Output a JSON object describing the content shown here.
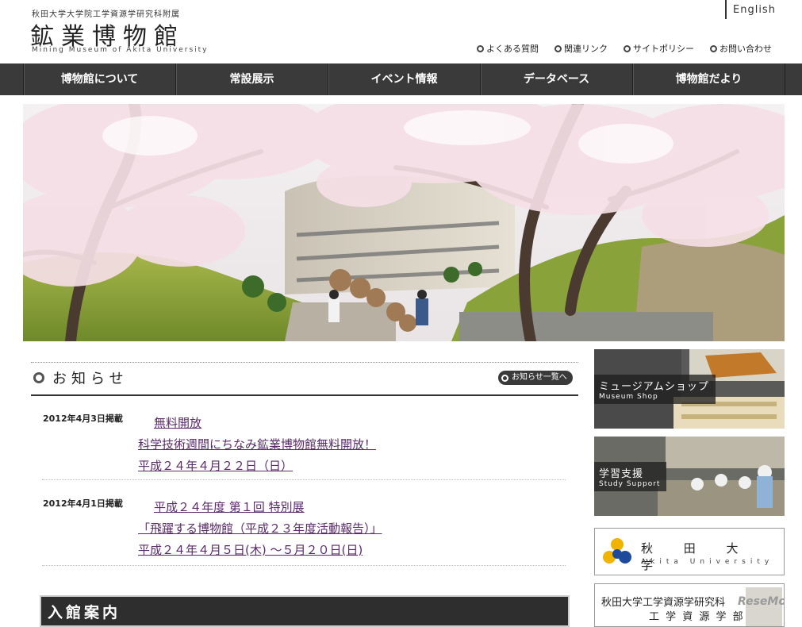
{
  "header": {
    "university_line": "秋田大学大学院工学資源学研究科附属",
    "logo_jp": "鉱業博物館",
    "logo_en": "Mining Museum of Akita University",
    "english_link": "English",
    "util_links": [
      "よくある質問",
      "関連リンク",
      "サイトポリシー",
      "お問い合わせ"
    ]
  },
  "nav": {
    "items": [
      "博物館について",
      "常設展示",
      "イベント情報",
      "データベース",
      "博物館だより"
    ]
  },
  "news": {
    "heading": "お知らせ",
    "list_button": "お知らせ一覧へ",
    "items": [
      {
        "date": "2012年4月3日掲載",
        "line1": "無料開放",
        "line2": "科学技術週間にちなみ鉱業博物館無料開放！",
        "line3": "平成２４年４月２２日（日）"
      },
      {
        "date": "2012年4月1日掲載",
        "line1": "平成２４年度 第１回 特別展",
        "line2": "「飛躍する博物館（平成２３年度活動報告）」",
        "line3": "平成２４年４月５日(木) ～５月２０日(日)"
      }
    ]
  },
  "visit": {
    "title": "入館案内"
  },
  "sidebar": {
    "shop": {
      "jp": "ミュージアムショップ",
      "en": "Museum Shop"
    },
    "study": {
      "jp": "学習支援",
      "en": "Study Support"
    },
    "akita": {
      "jp": "秋 田 大 学",
      "en": "Akita University"
    },
    "faculty": {
      "line1": "秋田大学工学資源学研究科",
      "line2": "工 学 資 源 学 部"
    }
  },
  "watermark": "ReseMom",
  "colors": {
    "nav_bg": "#3a3a3a",
    "link": "#5a2a6a"
  }
}
